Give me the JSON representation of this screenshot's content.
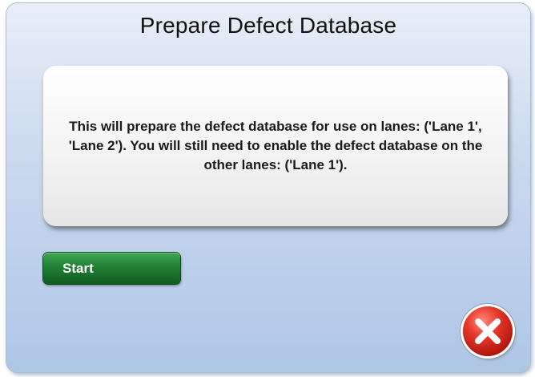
{
  "dialog": {
    "title": "Prepare Defect Database",
    "message": "This will prepare the defect database for use on lanes: ('Lane 1', 'Lane 2'). You will still need to enable the defect database on the other lanes: ('Lane 1').",
    "start_label": "Start",
    "close_icon": "close-x-icon"
  },
  "colors": {
    "background_top": "#e7eef8",
    "background_bottom": "#aec6e6",
    "start_button": "#1f7d33",
    "close_button": "#e5382a"
  }
}
